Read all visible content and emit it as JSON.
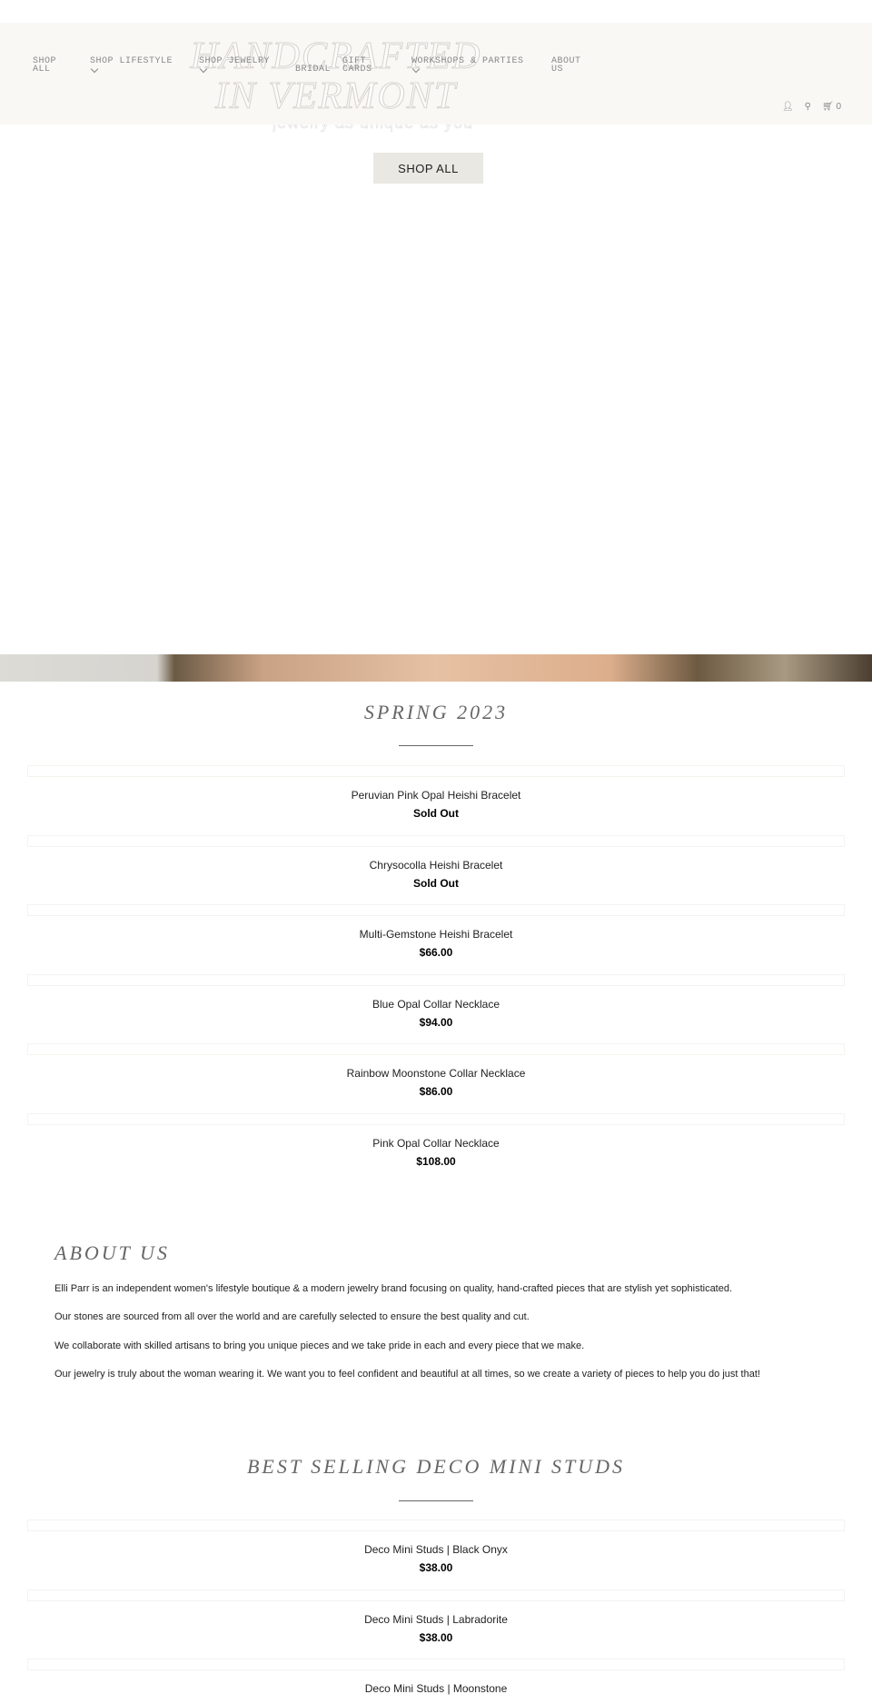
{
  "hero": {
    "title": "HANDCRAFTED IN VERMONT",
    "subtitle": "jewelry as unique as you",
    "button": "SHOP ALL"
  },
  "nav": [
    {
      "label": "SHOP ALL"
    },
    {
      "label": "SHOP LIFESTYLE"
    },
    {
      "label": "SHOP JEWELRY"
    },
    {
      "label": "BRIDAL"
    },
    {
      "label": "GIFT CARDS"
    },
    {
      "label": "WORKSHOPS & PARTIES"
    },
    {
      "label": "ABOUT US"
    }
  ],
  "header_icons": {
    "account": "user-icon",
    "search": "search-icon",
    "cart": "cart-icon",
    "cart_count": "0"
  },
  "spring": {
    "title": "SPRING 2023",
    "products": [
      {
        "name": "Peruvian Pink Opal Heishi Bracelet",
        "price": "Sold Out"
      },
      {
        "name": "Chrysocolla Heishi Bracelet",
        "price": "Sold Out"
      },
      {
        "name": "Multi-Gemstone Heishi Bracelet",
        "price": "$66.00"
      },
      {
        "name": "Blue Opal Collar Necklace",
        "price": "$94.00"
      },
      {
        "name": "Rainbow Moonstone Collar Necklace",
        "price": "$86.00"
      },
      {
        "name": "Pink Opal Collar Necklace",
        "price": "$108.00"
      }
    ]
  },
  "about": {
    "title": "ABOUT US",
    "paragraphs": [
      "Elli Parr is an independent women's lifestyle boutique & a modern jewelry brand focusing on quality, hand-crafted pieces that are stylish yet sophisticated.",
      "Our stones are sourced from all over the world and are carefully selected to ensure the best quality and cut.",
      "We collaborate with skilled artisans to bring you unique pieces and we take pride in each and every piece that we make.",
      "Our jewelry is truly about the woman wearing it. We want you to feel confident and beautiful at all times, so we create a variety of pieces to help you do just that!"
    ]
  },
  "best": {
    "title": "BEST SELLING DECO MINI STUDS",
    "products": [
      {
        "name": "Deco Mini Studs | Black Onyx",
        "price": "$38.00"
      },
      {
        "name": "Deco Mini Studs | Labradorite",
        "price": "$38.00"
      },
      {
        "name": "Deco Mini Studs | Moonstone"
      }
    ]
  }
}
